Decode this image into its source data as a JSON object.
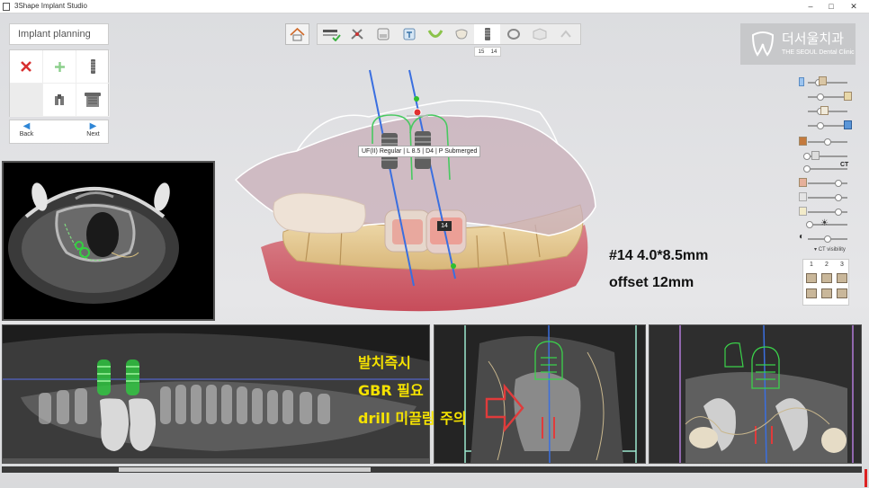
{
  "window": {
    "title": "3Shape Implant Studio",
    "controls": [
      "–",
      "□",
      "✕"
    ]
  },
  "left_panel": {
    "title": "Implant planning",
    "tools": [
      {
        "name": "delete-implant",
        "icon": "red-x-icon"
      },
      {
        "name": "add-implant",
        "icon": "plus-icon"
      },
      {
        "name": "implant-library",
        "icon": "implant-icon"
      },
      {
        "name": "empty-slot",
        "icon": ""
      },
      {
        "name": "abutment",
        "icon": "abutment-icon"
      },
      {
        "name": "sleeve",
        "icon": "sleeve-icon"
      }
    ],
    "nav": {
      "back": "Back",
      "next": "Next"
    }
  },
  "toolbar": {
    "home_icon": "home-icon",
    "buttons": [
      "scan-align-icon",
      "tools-icon",
      "crown-box-icon",
      "tooth-plan-icon",
      "arch-icon",
      "tooth-icon",
      "implant-icon",
      "guide-icon",
      "cube-icon",
      "arrow-icon"
    ],
    "active_index": 6,
    "tooth_numbers": [
      "15",
      "14"
    ]
  },
  "logo": {
    "main": "더서울치과",
    "sub": "THE SEOUL Dental Clinic"
  },
  "model_view": {
    "implant_label": "UF(II) Regular | L 8.5 | D4 | P Submerged",
    "tooth_tag": "14"
  },
  "annotation": {
    "line1": "#14 4.0*8.5mm",
    "line2": "offset 12mm"
  },
  "right_panel": {
    "ct_label": "CT",
    "ct_visibility": "CT visibility",
    "view_numbers": [
      "1",
      "2",
      "3"
    ]
  },
  "notes": {
    "line1": "발치즉시",
    "line2": "GBR 필요",
    "line3": "drill 미끌림 주의"
  },
  "colors": {
    "accent_blue": "#2f86d6",
    "implant_green": "#2fcf4a",
    "note_yellow": "#f5e200",
    "cross_section_frame_1": "#9be8cf",
    "cross_section_frame_2": "#b27ad8"
  }
}
